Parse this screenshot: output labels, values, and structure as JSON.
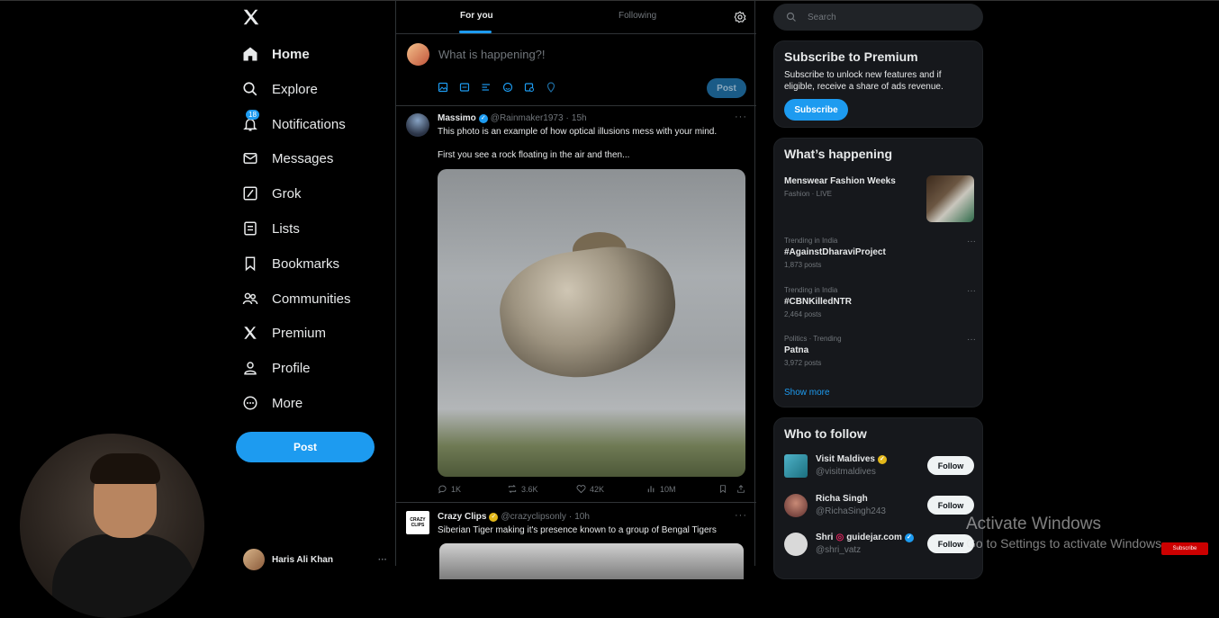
{
  "colors": {
    "accent": "#1d9bf0",
    "background": "#000000",
    "card": "#16181c",
    "muted": "#71767b"
  },
  "nav": {
    "logo_icon": "x-logo-icon",
    "items": [
      {
        "label": "Home",
        "icon": "home-icon"
      },
      {
        "label": "Explore",
        "icon": "search-icon"
      },
      {
        "label": "Notifications",
        "icon": "bell-icon",
        "badge": "18"
      },
      {
        "label": "Messages",
        "icon": "envelope-icon"
      },
      {
        "label": "Grok",
        "icon": "grok-icon"
      },
      {
        "label": "Lists",
        "icon": "list-icon"
      },
      {
        "label": "Bookmarks",
        "icon": "bookmark-icon"
      },
      {
        "label": "Communities",
        "icon": "people-icon"
      },
      {
        "label": "Premium",
        "icon": "x-logo-icon"
      },
      {
        "label": "Profile",
        "icon": "person-icon"
      },
      {
        "label": "More",
        "icon": "more-circle-icon"
      }
    ],
    "post_label": "Post",
    "account_name": "Haris Ali Khan"
  },
  "tabs": [
    {
      "label": "For you",
      "active": true
    },
    {
      "label": "Following",
      "active": false
    }
  ],
  "compose": {
    "placeholder": "What is happening?!",
    "post_label": "Post"
  },
  "tweets": [
    {
      "name": "Massimo",
      "handle": "@Rainmaker1973",
      "time": "15h",
      "text1": "This photo is an example of how optical illusions mess with your mind.",
      "text2": "First you see a rock floating in the air and then...",
      "replies": "1K",
      "reposts": "3.6K",
      "likes": "42K",
      "views": "10M"
    },
    {
      "name": "Crazy Clips",
      "handle": "@crazyclipsonly",
      "time": "10h",
      "text1": "Siberian Tiger making it's presence known to a group of Bengal Tigers",
      "avatar_text": "CRAZY CLIPS"
    }
  ],
  "search": {
    "placeholder": "Search"
  },
  "premium": {
    "title": "Subscribe to Premium",
    "text": "Subscribe to unlock new features and if eligible, receive a share of ads revenue.",
    "button": "Subscribe"
  },
  "happening": {
    "title": "What’s happening",
    "items": [
      {
        "context": "Fashion · LIVE",
        "title": "Menswear Fashion Weeks",
        "count": ""
      },
      {
        "context": "Trending in India",
        "title": "#AgainstDharaviProject",
        "count": "1,873 posts"
      },
      {
        "context": "Trending in India",
        "title": "#CBNKilledNTR",
        "count": "2,464 posts"
      },
      {
        "context": "Politics · Trending",
        "title": "Patna",
        "count": "3,972 posts"
      }
    ],
    "show_more": "Show more"
  },
  "who_to_follow": {
    "title": "Who to follow",
    "follow_label": "Follow",
    "users": [
      {
        "name": "Visit Maldives",
        "handle": "@visitmaldives"
      },
      {
        "name": "Richa Singh",
        "handle": "@RichaSingh243"
      },
      {
        "name": "Shri",
        "extra": "guidejar.com",
        "handle": "@shri_vatz"
      }
    ]
  },
  "watermark": {
    "line1": "Activate Windows",
    "line2": "Go to Settings to activate Windows."
  },
  "yt_subscribe": "Subscribe"
}
